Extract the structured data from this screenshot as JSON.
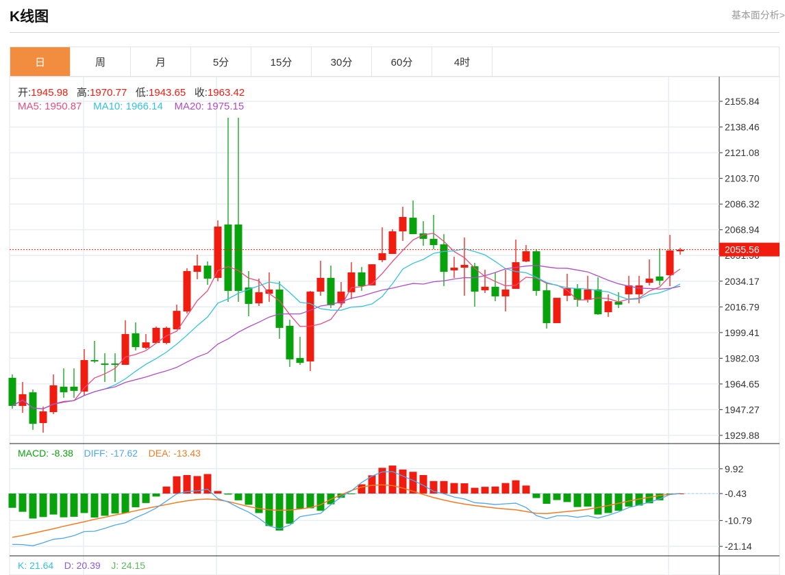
{
  "header": {
    "title": "K线图",
    "link": "基本面分析>"
  },
  "tabs": [
    {
      "label": "日",
      "active": true
    },
    {
      "label": "周"
    },
    {
      "label": "月"
    },
    {
      "label": "5分"
    },
    {
      "label": "15分"
    },
    {
      "label": "30分"
    },
    {
      "label": "60分"
    },
    {
      "label": "4时"
    }
  ],
  "ohlc_info": {
    "open_label": "开:",
    "open": "1945.98",
    "high_label": "高:",
    "high": "1970.77",
    "low_label": "低:",
    "low": "1943.65",
    "close_label": "收:",
    "close": "1963.42"
  },
  "ma_info": {
    "ma5": "MA5: 1950.87",
    "ma10": "MA10: 1966.14",
    "ma20": "MA20: 1975.15"
  },
  "macd_info": {
    "macd": "MACD: -8.38",
    "diff": "DIFF: -17.62",
    "dea": "DEA: -13.43"
  },
  "kdj_info": {
    "k": "K: 21.64",
    "d": "D: 20.39",
    "j": "J: 24.15"
  },
  "colors": {
    "up": "#f01c10",
    "down": "#08a30c",
    "ma5": "#ea4c7c",
    "ma10": "#33c3dc",
    "ma20": "#b04cc4",
    "diff": "#4ea6ec",
    "dea": "#f57a1f",
    "tab_active": "#f28c3f"
  },
  "chart_data": [
    {
      "type": "candlestick",
      "ylim": [
        1929.88,
        2155.84
      ],
      "y_ticks": [
        "2155.84",
        "2138.46",
        "2121.08",
        "2103.70",
        "2086.32",
        "2068.94",
        "2051.56",
        "2034.17",
        "2016.79",
        "1999.41",
        "1982.03",
        "1964.65",
        "1947.27",
        "1929.88"
      ],
      "current_price": "2055.56",
      "grid": true,
      "moving_averages": [
        5,
        10,
        20
      ],
      "candles": [
        [
          1968.8,
          1971.1,
          1947.9,
          1949.8
        ],
        [
          1949.8,
          1966.0,
          1945.1,
          1957.7
        ],
        [
          1959.0,
          1960.9,
          1933.6,
          1937.7
        ],
        [
          1938.2,
          1949.3,
          1931.7,
          1946.1
        ],
        [
          1945.6,
          1971.1,
          1944.2,
          1963.7
        ],
        [
          1962.8,
          1975.2,
          1955.3,
          1959.0
        ],
        [
          1962.8,
          1975.2,
          1955.3,
          1960.0
        ],
        [
          1959.5,
          1988.2,
          1956.7,
          1980.8
        ],
        [
          1980.8,
          1993.8,
          1978.9,
          1979.9
        ],
        [
          1978.5,
          1985.4,
          1966.0,
          1977.6
        ],
        [
          1978.5,
          1985.4,
          1966.0,
          1977.6
        ],
        [
          1977.6,
          2007.7,
          1977.6,
          1998.4
        ],
        [
          1998.9,
          2006.3,
          1987.3,
          1989.6
        ],
        [
          1989.1,
          1998.4,
          1988.2,
          1992.8
        ],
        [
          1992.4,
          2003.5,
          1991.9,
          2002.6
        ],
        [
          1992.4,
          2003.5,
          1991.5,
          2002.6
        ],
        [
          2001.6,
          2018.3,
          2001.6,
          2014.1
        ],
        [
          2013.7,
          2042.9,
          2012.3,
          2041.0
        ],
        [
          2040.5,
          2052.1,
          2035.5,
          2044.7
        ],
        [
          2044.7,
          2047.5,
          2031.7,
          2035.9
        ],
        [
          2036.4,
          2075.3,
          2034.1,
          2071.1
        ],
        [
          2072.5,
          2144.7,
          2020.2,
          2027.6
        ],
        [
          2072.5,
          2144.7,
          2020.2,
          2027.6
        ],
        [
          2029.9,
          2041.0,
          2010.4,
          2018.8
        ],
        [
          2019.2,
          2035.9,
          2017.4,
          2026.7
        ],
        [
          2025.7,
          2040.1,
          2020.2,
          2028.5
        ],
        [
          2028.5,
          2034.1,
          1995.2,
          2002.6
        ],
        [
          2004.0,
          2008.1,
          1976.2,
          1981.3
        ],
        [
          1982.2,
          1996.5,
          1977.6,
          1978.9
        ],
        [
          1979.9,
          2027.6,
          1973.4,
          2027.1
        ],
        [
          2027.1,
          2048.0,
          2024.3,
          2036.4
        ],
        [
          2036.4,
          2044.7,
          2016.0,
          2017.9
        ],
        [
          2019.2,
          2033.6,
          2016.5,
          2027.1
        ],
        [
          2026.7,
          2047.0,
          2022.0,
          2040.1
        ],
        [
          2040.1,
          2043.8,
          2027.6,
          2030.8
        ],
        [
          2031.3,
          2045.6,
          2031.3,
          2045.6
        ],
        [
          2048.4,
          2070.6,
          2047.0,
          2053.1
        ],
        [
          2052.6,
          2069.3,
          2052.6,
          2067.9
        ],
        [
          2067.9,
          2084.5,
          2061.4,
          2077.6
        ],
        [
          2077.1,
          2088.7,
          2066.0,
          2066.0
        ],
        [
          2066.5,
          2074.8,
          2058.1,
          2062.8
        ],
        [
          2062.8,
          2079.0,
          2055.8,
          2058.6
        ],
        [
          2059.1,
          2066.0,
          2030.8,
          2040.5
        ],
        [
          2041.5,
          2050.7,
          2036.4,
          2043.3
        ],
        [
          2043.3,
          2063.7,
          2024.3,
          2045.2
        ],
        [
          2044.3,
          2046.6,
          2016.9,
          2027.1
        ],
        [
          2028.0,
          2041.9,
          2026.2,
          2030.4
        ],
        [
          2030.4,
          2040.1,
          2020.6,
          2023.9
        ],
        [
          2023.9,
          2041.9,
          2013.7,
          2028.5
        ],
        [
          2029.0,
          2062.3,
          2029.0,
          2047.0
        ],
        [
          2047.5,
          2058.6,
          2047.0,
          2054.4
        ],
        [
          2054.4,
          2055.4,
          2024.3,
          2027.6
        ],
        [
          2028.0,
          2033.1,
          2002.1,
          2005.8
        ],
        [
          2005.8,
          2022.9,
          2005.8,
          2022.9
        ],
        [
          2024.3,
          2039.2,
          2020.6,
          2029.4
        ],
        [
          2029.4,
          2032.2,
          2016.9,
          2021.6
        ],
        [
          2021.6,
          2037.8,
          2019.7,
          2028.5
        ],
        [
          2028.5,
          2036.8,
          2011.4,
          2011.8
        ],
        [
          2013.2,
          2025.3,
          2010.0,
          2020.6
        ],
        [
          2020.2,
          2026.7,
          2016.0,
          2018.3
        ],
        [
          2025.3,
          2037.8,
          2019.2,
          2031.3
        ],
        [
          2025.3,
          2037.8,
          2019.2,
          2031.3
        ],
        [
          2033.1,
          2048.9,
          2031.3,
          2035.9
        ],
        [
          2037.3,
          2056.3,
          2031.3,
          2034.5
        ],
        [
          2038.2,
          2065.5,
          2030.8,
          2054.9
        ],
        [
          2054.4,
          2056.7,
          2052.1,
          2055.4
        ]
      ]
    },
    {
      "type": "bar",
      "ylim": [
        -21.14,
        9.92
      ],
      "y_ticks": [
        "9.92",
        "-0.43",
        "-10.79",
        "-21.14"
      ],
      "macd": [
        -5.7,
        -7.3,
        -10.0,
        -9.4,
        -8.4,
        -9.5,
        -9.3,
        -7.8,
        -9.6,
        -8.9,
        -8.0,
        -7.8,
        -5.5,
        -3.8,
        -1.2,
        2.8,
        6.9,
        7.4,
        7.0,
        7.8,
        1.0,
        -0.4,
        -2.7,
        -4.5,
        -7.8,
        -13.0,
        -14.8,
        -12.1,
        -6.1,
        -5.9,
        -6.9,
        -4.3,
        -1.7,
        -0.2,
        3.7,
        7.3,
        10.3,
        11.2,
        9.6,
        8.7,
        7.4,
        5.0,
        5.0,
        4.2,
        4.1,
        2.3,
        2.7,
        2.8,
        4.2,
        5.3,
        3.2,
        -1.8,
        -4.1,
        -2.6,
        -3.4,
        -5.4,
        -5.2,
        -8.4,
        -7.8,
        -6.9,
        -5.2,
        -4.8,
        -3.9,
        -2.7,
        -0.2,
        0.0
      ],
      "dea": [
        -17.5,
        -16.8,
        -15.9,
        -15.0,
        -14.1,
        -13.1,
        -12.2,
        -11.3,
        -10.3,
        -9.5,
        -8.6,
        -7.8,
        -6.9,
        -6.0,
        -5.2,
        -4.4,
        -3.6,
        -2.9,
        -2.4,
        -2.2,
        -2.5,
        -3.2,
        -4.2,
        -5.2,
        -6.0,
        -6.5,
        -6.7,
        -6.6,
        -6.2,
        -5.6,
        -4.5,
        -2.3,
        -0.5,
        1.2,
        2.6,
        3.3,
        3.5,
        3.2,
        2.2,
        0.9,
        -0.4,
        -1.6,
        -2.6,
        -3.5,
        -4.2,
        -4.8,
        -5.3,
        -5.8,
        -6.2,
        -6.5,
        -7.2,
        -7.9,
        -8.0,
        -7.6,
        -7.2,
        -6.8,
        -6.3,
        -5.6,
        -4.8,
        -3.9,
        -3.0,
        -2.2,
        -1.5,
        -0.8,
        -0.3,
        0.0
      ]
    }
  ]
}
